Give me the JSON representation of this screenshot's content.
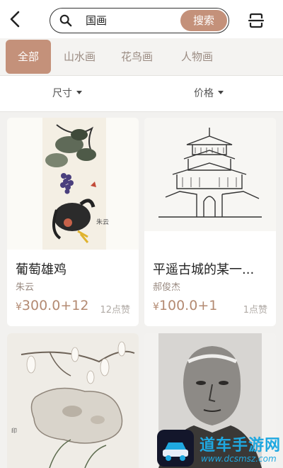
{
  "search": {
    "query": "国画",
    "button_label": "搜索"
  },
  "categories": [
    {
      "label": "全部",
      "active": true
    },
    {
      "label": "山水画",
      "active": false
    },
    {
      "label": "花鸟画",
      "active": false
    },
    {
      "label": "人物画",
      "active": false
    }
  ],
  "filters": {
    "size_label": "尺寸",
    "price_label": "价格"
  },
  "products": [
    {
      "title": "葡萄雄鸡",
      "artist": "朱云",
      "currency": "¥",
      "price": "300.0+12",
      "likes": "12点赞"
    },
    {
      "title": "平遥古城的某一...",
      "artist": "郝俊杰",
      "currency": "¥",
      "price": "100.0+1",
      "likes": "1点赞"
    },
    {
      "title": "",
      "artist": "",
      "currency": "",
      "price": "",
      "likes": ""
    },
    {
      "title": "",
      "artist": "",
      "currency": "",
      "price": "",
      "likes": ""
    }
  ],
  "watermark": {
    "title": "道车手游网",
    "url": "www.dcsmsz.com"
  },
  "colors": {
    "accent": "#c4917a",
    "price": "#b38a72",
    "muted": "#9a8b82",
    "watermark": "#1fa8e0"
  }
}
